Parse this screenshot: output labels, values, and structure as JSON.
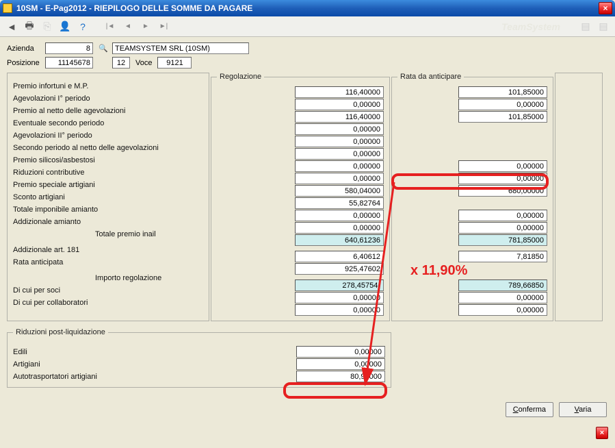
{
  "window": {
    "title": "10SM  -  E-Pag2012  -  RIEPILOGO DELLE SOMME DA PAGARE"
  },
  "toolbar": {
    "brand": "TeamSystem"
  },
  "header": {
    "azienda_label": "Azienda",
    "azienda_code": "8",
    "azienda_name": "TEAMSYSTEM SRL (10SM)",
    "posizione_label": "Posizione",
    "posizione": "11145678",
    "voce_code": "12",
    "voce_label": "Voce",
    "voce": "9121"
  },
  "sections": {
    "regolazione_legend": "Regolazione",
    "rata_legend": "Rata da anticipare",
    "post_legend": "Riduzioni post-liquidazione"
  },
  "rows": {
    "r01": "Premio infortuni e M.P.",
    "r02": "Agevolazioni I° periodo",
    "r03": "Premio al netto delle agevolazioni",
    "r04": "Eventuale secondo periodo",
    "r05": "Agevolazioni II° periodo",
    "r06": "Secondo periodo al netto delle agevolazioni",
    "r07": "Premio silicosi/asbestosi",
    "r08": "Riduzioni contributive",
    "r09": "Premio speciale artigiani",
    "r10": "Sconto artigiani",
    "r11": "Totale imponibile amianto",
    "r12": "Addizionale amianto",
    "r13": "Totale premio inail",
    "r14": "Addizionale art. 181",
    "r15": "Rata anticipata",
    "r16": "Importo regolazione",
    "r17": "Di cui per soci",
    "r18": "Di cui per collaboratori"
  },
  "reg": {
    "r01": "116,40000",
    "r02": "0,00000",
    "r03": "116,40000",
    "r04": "0,00000",
    "r05": "0,00000",
    "r06": "0,00000",
    "r07": "0,00000",
    "r08": "0,00000",
    "r09": "580,04000",
    "r10": "55,82764",
    "r11": "0,00000",
    "r12": "0,00000",
    "r13": "640,61236",
    "r14": "6,40612",
    "r15": "925,47602",
    "r16": "278,45754-",
    "r17": "0,00000",
    "r18": "0,00000"
  },
  "rata": {
    "r01": "101,85000",
    "r02": "0,00000",
    "r03": "101,85000",
    "r07": "0,00000",
    "r08": "0,00000",
    "r09": "680,00000",
    "r11": "0,00000",
    "r12": "0,00000",
    "r13": "781,85000",
    "r14": "7,81850",
    "r16": "789,66850",
    "r17": "0,00000",
    "r18": "0,00000"
  },
  "post": {
    "edili_label": "Edili",
    "edili": "0,00000",
    "artigiani_label": "Artigiani",
    "artigiani": "0,00000",
    "auto_label": "Autotrasportatori artigiani",
    "auto": "80,92000"
  },
  "buttons": {
    "conferma": "Conferma",
    "varia": "Varia"
  },
  "annotation": {
    "text": "x 11,90%"
  }
}
